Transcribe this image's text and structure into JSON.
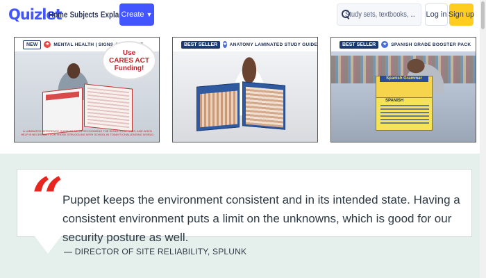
{
  "header": {
    "logo": "Quizlet",
    "nav": [
      "Home",
      "Subjects",
      "Explanations"
    ],
    "create_label": "Create",
    "search_placeholder": "Study sets, textbooks, ...",
    "login_label": "Log in",
    "signup_label": "Sign up"
  },
  "ads": [
    {
      "badge": "NEW",
      "banner": "MENTAL HEALTH | SIGNS & SUPPORT",
      "callout_line1": "Use",
      "callout_line2": "CARES ACT",
      "callout_line3": "Funding!",
      "caption": "A LAMINATED REFERENCE GUIDE TO AID IN RECOGNIZING THE SIGNS, SYMPTOMS, AND WHEN HELP IS NECESSARY FOR THOSE STRUGGLING WITH SCHOOL IN TODAY'S CHALLENGING WORLD."
    },
    {
      "badge": "BEST SELLER",
      "banner": "ANATOMY LAMINATED STUDY GUIDE"
    },
    {
      "badge": "BEST SELLER",
      "banner": "SPANISH GRADE BOOSTER PACK",
      "card_tab": "Spanish Grammar",
      "card_label": "SPANISH"
    }
  ],
  "testimonial": {
    "quote_mark": "“",
    "text": "Puppet keeps the environment consistent and in its intended state. Having a consistent environment puts a limit on the unknowns, which is good for our security posture as well.",
    "author": "— DIRECTOR OF SITE RELIABILITY, SPLUNK"
  },
  "colors": {
    "brand": "#4255ff",
    "signup": "#ffcd1f",
    "quote_accent": "#e8251f",
    "section_bg": "#e5efec"
  },
  "icons": {
    "search": "search-icon",
    "create_chevron": "chevron-down-icon"
  }
}
